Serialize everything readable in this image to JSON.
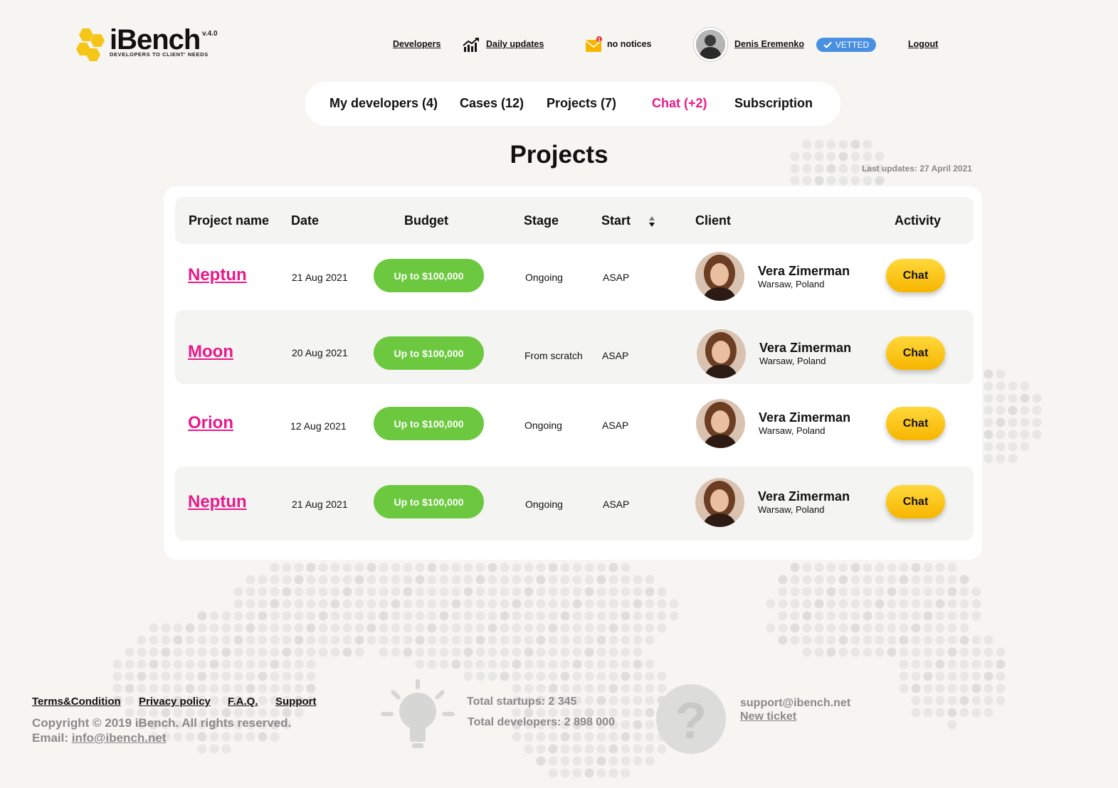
{
  "header": {
    "logo_text": "iBench",
    "logo_version": "v.4.0",
    "logo_tagline": "DEVELOPERS TO CLIENT' NEEDS",
    "developers_link": "Developers",
    "daily_updates_link": "Daily updates",
    "notices_text": "no notices",
    "notices_badge": "1",
    "user_name": "Denis Eremenko",
    "vetted_label": "VETTED",
    "logout_label": "Logout"
  },
  "nav": {
    "my_developers": "My developers (4)",
    "cases": "Cases (12)",
    "projects": "Projects (7)",
    "chat": "Chat (+2)",
    "subscription": "Subscription"
  },
  "page": {
    "title": "Projects",
    "last_updates": "Last updates: 27 April 2021"
  },
  "table": {
    "columns": {
      "project_name": "Project name",
      "date": "Date",
      "budget": "Budget",
      "stage": "Stage",
      "start": "Start",
      "client": "Client",
      "activity": "Activity"
    },
    "rows": [
      {
        "name": "Neptun",
        "date": "21 Aug 2021",
        "budget": "Up to $100,000",
        "stage": "Ongoing",
        "start": "ASAP",
        "client_name": "Vera Zimerman",
        "client_location": "Warsaw, Poland",
        "action": "Chat"
      },
      {
        "name": "Moon",
        "date": "20 Aug 2021",
        "budget": "Up to $100,000",
        "stage": "From scratch",
        "start": "ASAP",
        "client_name": "Vera Zimerman",
        "client_location": "Warsaw, Poland",
        "action": "Chat"
      },
      {
        "name": "Orion",
        "date": "12 Aug 2021",
        "budget": "Up to $100,000",
        "stage": "Ongoing",
        "start": "ASAP",
        "client_name": "Vera Zimerman",
        "client_location": "Warsaw, Poland",
        "action": "Chat"
      },
      {
        "name": "Neptun",
        "date": "21 Aug 2021",
        "budget": "Up to $100,000",
        "stage": "Ongoing",
        "start": "ASAP",
        "client_name": "Vera Zimerman",
        "client_location": "Warsaw, Poland",
        "action": "Chat"
      }
    ]
  },
  "footer": {
    "terms": "Terms&Condition",
    "privacy": "Privacy policy",
    "faq": "F.A.Q.",
    "support": "Support",
    "copyright": "Copyright © 2019 iBench. All rights reserved.",
    "email_label": "Email:",
    "email": "info@ibench.net",
    "total_startups": "Total startups: 2 345",
    "total_developers": "Total developers: 2 898 000",
    "support_email": "support@ibench.net",
    "new_ticket": "New ticket"
  },
  "colors": {
    "accent_pink": "#e8198b",
    "budget_green": "#6cc83f",
    "chat_yellow": "#f7b500",
    "vetted_blue": "#4a90e2",
    "logo_yellow": "#f5c518"
  },
  "icons": [
    "honeycomb-logo-icon",
    "chart-up-icon",
    "envelope-icon",
    "check-icon",
    "sort-icon",
    "lightbulb-icon",
    "question-icon"
  ]
}
